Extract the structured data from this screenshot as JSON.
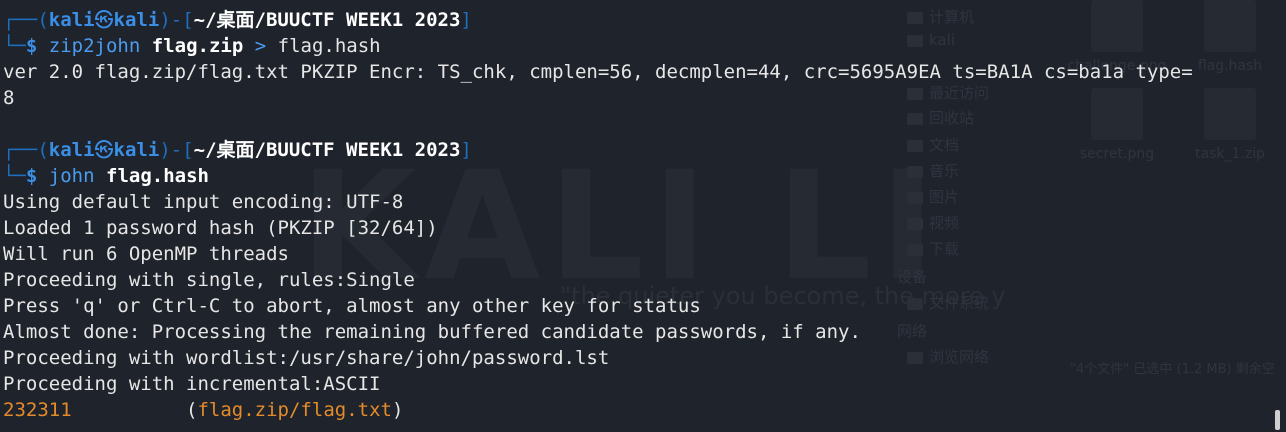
{
  "background": {
    "watermark": "KALI LI",
    "watermark_sub": "\"the quieter you become, the more y",
    "sidebar": [
      "计算机",
      "kali",
      "最近访问",
      "回收站",
      "文档",
      "音乐",
      "图片",
      "视频",
      "下载"
    ],
    "devices_heading": "设备",
    "devices": [
      "文件系统"
    ],
    "network_heading": "网络",
    "network": [
      "浏览网络"
    ],
    "files": [
      "challenge.png",
      "flag.hash",
      "secret.png",
      "task_1.zip"
    ],
    "status": "\"4个文件\" 已选中 (1.2 MB) 剩余空"
  },
  "prompt": {
    "frame_top": "┌──(",
    "user": "kali",
    "skull": "㉿",
    "host": "kali",
    "sep": ")-[",
    "path": "~/桌面/BUUCTF WEEK1 2023",
    "close": "]",
    "frame_bottom": "└─",
    "dollar": "$ "
  },
  "command1": {
    "cmd": "zip2john",
    "arg1": "flag.zip",
    "redir": ">",
    "arg2": "flag.hash"
  },
  "output1": [
    "ver 2.0 flag.zip/flag.txt PKZIP Encr: TS_chk, cmplen=56, decmplen=44, crc=5695A9EA ts=BA1A cs=ba1a type=",
    "8"
  ],
  "command2": {
    "cmd": "john",
    "arg1": "flag.hash"
  },
  "output2": [
    "Using default input encoding: UTF-8",
    "Loaded 1 password hash (PKZIP [32/64])",
    "Will run 6 OpenMP threads",
    "Proceeding with single, rules:Single",
    "Press 'q' or Ctrl-C to abort, almost any other key for status",
    "Almost done: Processing the remaining buffered candidate passwords, if any.",
    "Proceeding with wordlist:/usr/share/john/password.lst",
    "Proceeding with incremental:ASCII"
  ],
  "result": {
    "password": "232311",
    "gap": "          ",
    "file": "(flag.zip/flag.txt)"
  },
  "colors": {
    "accent": "#3a8ee6",
    "password": "#e58b2b",
    "bg": "#1f232b"
  }
}
